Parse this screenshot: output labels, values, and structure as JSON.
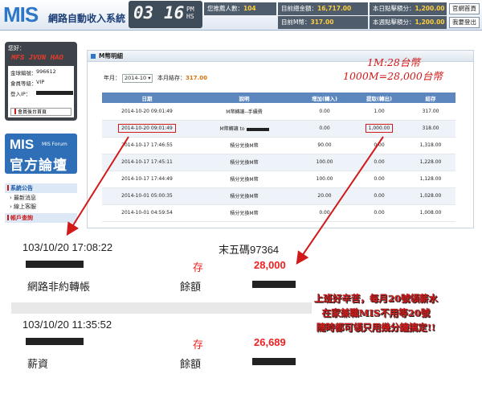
{
  "header": {
    "logo": "MIS",
    "app_title": "網路自動收入系統",
    "clock": {
      "hour": "03",
      "minute": "16",
      "ampm_top": "PM",
      "ampm_bottom": "HS"
    },
    "stats": [
      {
        "label": "您推薦人數：",
        "value": "104"
      },
      {
        "label": "目前總金額：",
        "value": "16,717.00"
      },
      {
        "label": "本日點擊積分：",
        "value": "1,200.00"
      },
      {
        "label": "目前M幣：",
        "value": "317.00"
      },
      {
        "label": "本週點擊積分：",
        "value": "1,200.00"
      }
    ],
    "buttons": {
      "home": "官網首頁",
      "logout": "我要登出"
    }
  },
  "user": {
    "greeting": "您好：",
    "name": "MFS JVUN HAO",
    "id_label": "金球編號：",
    "id_value": "996612",
    "level_label": "會員等級：",
    "level_value": "VIP",
    "ip_label": "登入IP：",
    "backend_link": "會員後台首頁"
  },
  "forum": {
    "mis": "MIS",
    "small": "MIS Forum",
    "big": "官方論壇"
  },
  "sidebar": {
    "section_notice": "系統公告",
    "items": [
      "最新消息",
      "線上客服"
    ],
    "section_account": "帳戶查詢"
  },
  "panel": {
    "title": "M幣明細",
    "year_month_label": "年月：",
    "year_month_value": "2014-10",
    "balance_label": "本月結存：",
    "balance_value": "317.00",
    "note_line1": "1M:28台幣",
    "note_line2": "1000M=28,000台幣",
    "columns": [
      "日期",
      "說明",
      "增加(轉入)",
      "提取(轉出)",
      "結存"
    ],
    "rows": [
      {
        "date": "2014-10-20 09:01:49",
        "desc": "M幣轉讓--手續費",
        "in": "0.00",
        "out": "1.00",
        "bal": "317.00"
      },
      {
        "date": "2014-10-20 09:01:49",
        "desc": "M幣轉讓 to",
        "in": "0.00",
        "out": "1,000.00",
        "bal": "318.00"
      },
      {
        "date": "2014-10-17 17:46:55",
        "desc": "積分兌換M幣",
        "in": "90.00",
        "out": "0.00",
        "bal": "1,318.00"
      },
      {
        "date": "2014-10-17 17:45:11",
        "desc": "積分兌換M幣",
        "in": "100.00",
        "out": "0.00",
        "bal": "1,228.00"
      },
      {
        "date": "2014-10-17 17:44:49",
        "desc": "積分兌換M幣",
        "in": "100.00",
        "out": "0.00",
        "bal": "1,128.00"
      },
      {
        "date": "2014-10-01 05:00:35",
        "desc": "積分兌換M幣",
        "in": "20.00",
        "out": "0.00",
        "bal": "1,028.00"
      },
      {
        "date": "2014-10-01 04:59:54",
        "desc": "積分兌換M幣",
        "in": "0.00",
        "out": "0.00",
        "bal": "1,008.00"
      }
    ]
  },
  "bank": {
    "entries": [
      {
        "datetime": "103/10/20 17:08:22",
        "ref": "末五碼97364",
        "type": "存",
        "amount": "28,000",
        "desc": "網路非約轉帳",
        "bal_label": "餘額"
      },
      {
        "datetime": "103/10/20 11:35:52",
        "type": "存",
        "amount": "26,689",
        "desc": "薪資",
        "bal_label": "餘額"
      }
    ]
  },
  "caption": {
    "line1": "上班好辛苦，每月20號領薪水",
    "line2": "在家兼職MIS不用等20號",
    "line3": "隨時都可領只用幾分鐘搞定!!"
  },
  "colors": {
    "accent": "#2e77c8",
    "highlight": "#d11a1a",
    "table_header": "#5b86be"
  }
}
